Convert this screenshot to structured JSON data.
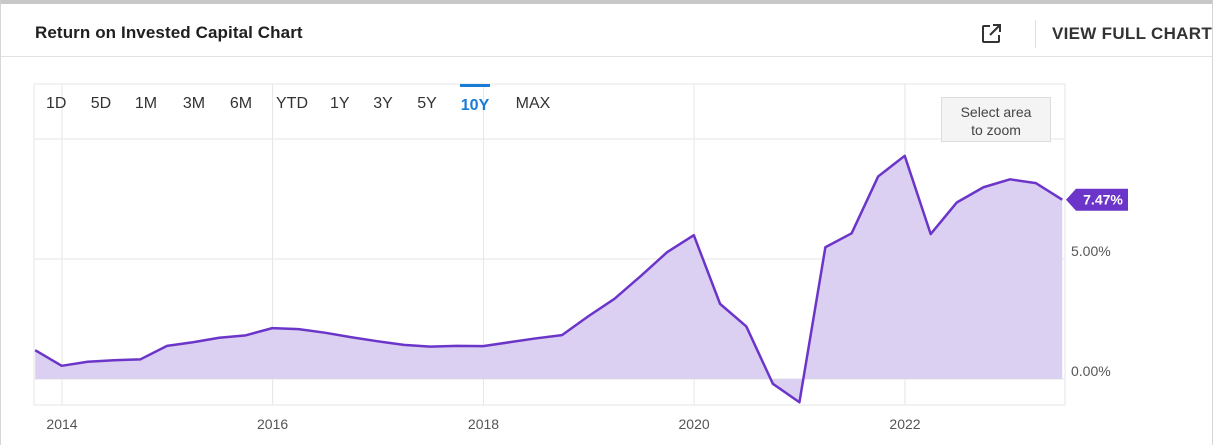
{
  "header": {
    "title": "Return on Invested Capital Chart",
    "full_chart_label": "VIEW FULL CHART",
    "external_icon": "external-link-icon"
  },
  "range_selector": {
    "options": [
      "1D",
      "5D",
      "1M",
      "3M",
      "6M",
      "YTD",
      "1Y",
      "3Y",
      "5Y",
      "10Y",
      "MAX"
    ],
    "selected": "10Y"
  },
  "zoom_hint": {
    "line1": "Select area",
    "line2": "to zoom"
  },
  "colors": {
    "line": "#6c35c9",
    "fill": "#d9cdf0",
    "active_range": "#1a7bd6",
    "grid": "#e6e6e6"
  },
  "chart_data": {
    "type": "area",
    "title": "",
    "xlabel": "",
    "ylabel": "",
    "x_ticks": [
      "2014",
      "2016",
      "2018",
      "2020",
      "2022"
    ],
    "y_ticks": [
      "0.00%",
      "5.00%"
    ],
    "ylim": [
      -1.0,
      10.0
    ],
    "grid": true,
    "last_value_label": "7.47%",
    "series": [
      {
        "values": [
          {
            "x": "2013-09-30",
            "y": 1.2
          },
          {
            "x": "2013-12-31",
            "y": 0.55
          },
          {
            "x": "2014-03-31",
            "y": 0.72
          },
          {
            "x": "2014-06-30",
            "y": 0.78
          },
          {
            "x": "2014-09-30",
            "y": 0.82
          },
          {
            "x": "2014-12-31",
            "y": 1.38
          },
          {
            "x": "2015-03-31",
            "y": 1.53
          },
          {
            "x": "2015-06-30",
            "y": 1.72
          },
          {
            "x": "2015-09-30",
            "y": 1.82
          },
          {
            "x": "2015-12-31",
            "y": 2.12
          },
          {
            "x": "2016-03-31",
            "y": 2.08
          },
          {
            "x": "2016-06-30",
            "y": 1.93
          },
          {
            "x": "2016-09-30",
            "y": 1.74
          },
          {
            "x": "2016-12-31",
            "y": 1.57
          },
          {
            "x": "2017-03-31",
            "y": 1.42
          },
          {
            "x": "2017-06-30",
            "y": 1.35
          },
          {
            "x": "2017-09-30",
            "y": 1.38
          },
          {
            "x": "2017-12-31",
            "y": 1.37
          },
          {
            "x": "2018-03-31",
            "y": 1.53
          },
          {
            "x": "2018-06-30",
            "y": 1.69
          },
          {
            "x": "2018-09-30",
            "y": 1.83
          },
          {
            "x": "2018-12-31",
            "y": 2.62
          },
          {
            "x": "2019-03-31",
            "y": 3.34
          },
          {
            "x": "2019-06-30",
            "y": 4.29
          },
          {
            "x": "2019-09-30",
            "y": 5.29
          },
          {
            "x": "2019-12-31",
            "y": 5.99
          },
          {
            "x": "2020-03-31",
            "y": 3.13
          },
          {
            "x": "2020-06-30",
            "y": 2.19
          },
          {
            "x": "2020-09-30",
            "y": -0.2
          },
          {
            "x": "2020-12-31",
            "y": -0.97
          },
          {
            "x": "2021-03-31",
            "y": 5.49
          },
          {
            "x": "2021-06-30",
            "y": 6.07
          },
          {
            "x": "2021-09-30",
            "y": 8.44
          },
          {
            "x": "2021-12-31",
            "y": 9.3
          },
          {
            "x": "2022-03-31",
            "y": 6.04
          },
          {
            "x": "2022-06-30",
            "y": 7.36
          },
          {
            "x": "2022-09-30",
            "y": 7.99
          },
          {
            "x": "2022-12-31",
            "y": 8.32
          },
          {
            "x": "2023-03-31",
            "y": 8.16
          },
          {
            "x": "2023-06-30",
            "y": 7.47
          }
        ]
      }
    ]
  }
}
